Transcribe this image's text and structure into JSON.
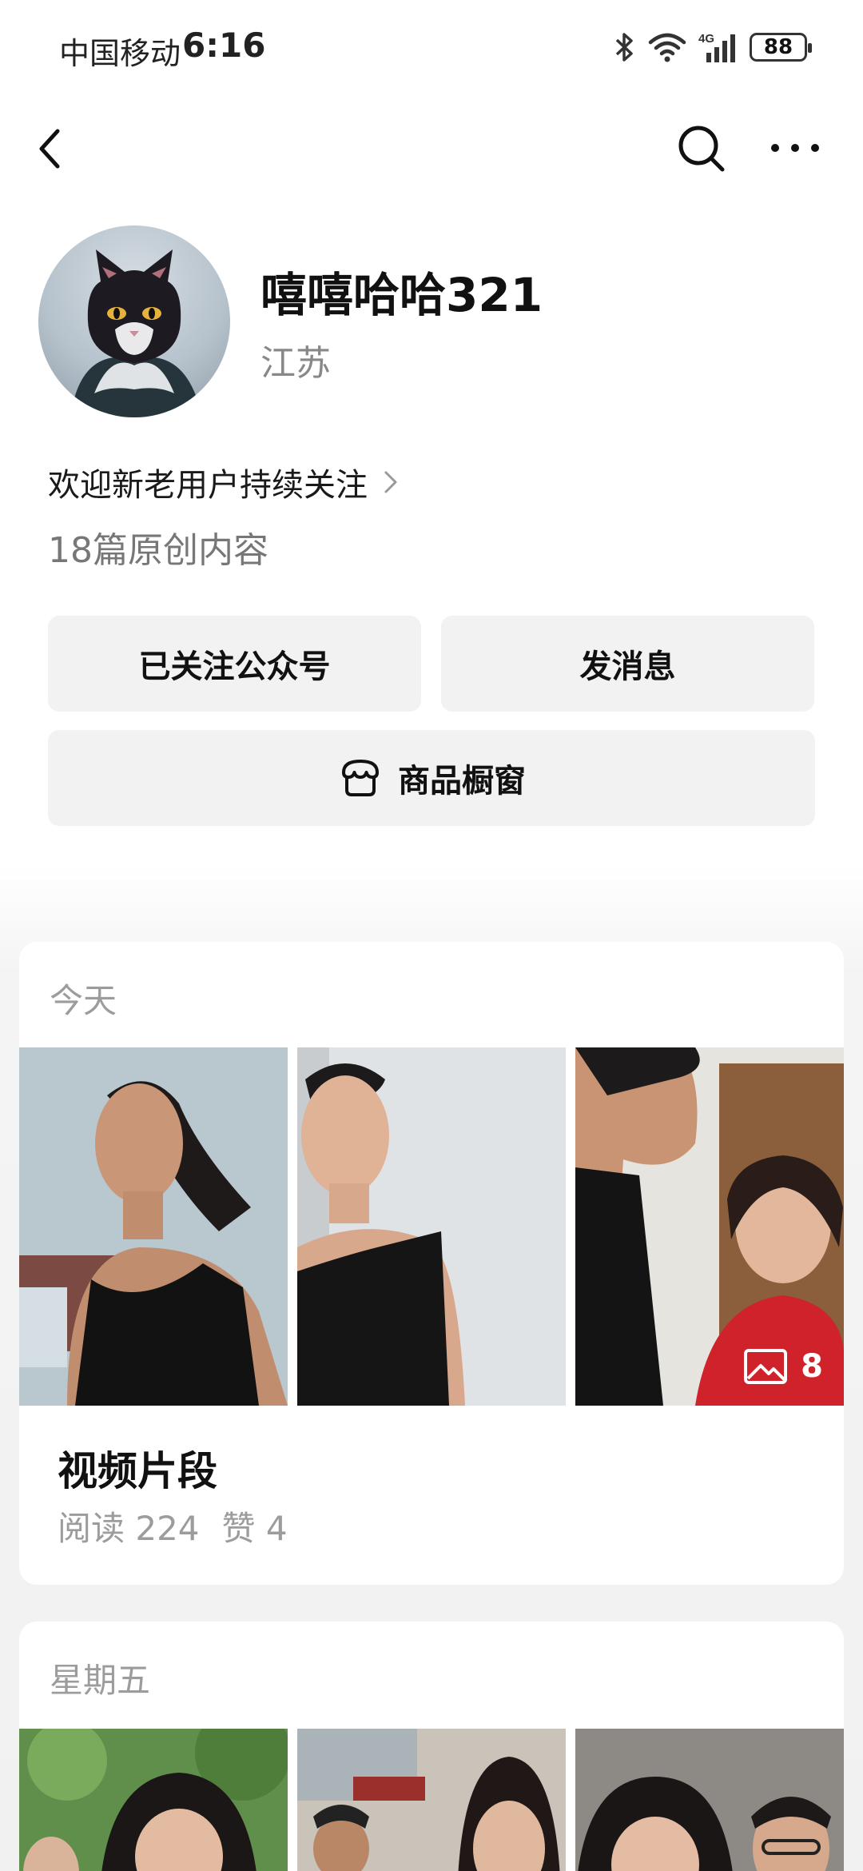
{
  "status_bar": {
    "carrier": "中国移动",
    "time": "6:16",
    "network": "4G",
    "battery": "88"
  },
  "nav": {
    "back_icon": "chevron-left-icon",
    "search_icon": "search-icon",
    "more_icon": "more-horizontal-icon"
  },
  "profile": {
    "name": "嘻嘻哈哈321",
    "region": "江苏",
    "intro": "欢迎新老用户持续关注",
    "original_count": "18篇原创内容"
  },
  "actions": {
    "follow_label": "已关注公众号",
    "message_label": "发消息",
    "shop_label": "商品橱窗"
  },
  "posts": [
    {
      "date": "今天",
      "title": "视频片段",
      "reads": "阅读 224",
      "likes": "赞 4",
      "image_count": "8"
    },
    {
      "date": "星期五"
    }
  ],
  "colors": {
    "button_bg": "#f2f2f2",
    "muted_text": "#9c9c9c",
    "page_bg": "#f1f1f1"
  }
}
